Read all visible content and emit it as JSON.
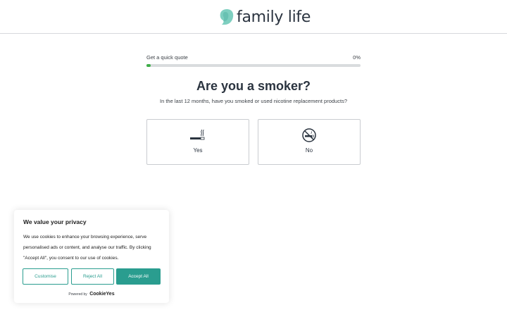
{
  "header": {
    "brand_name": "family life",
    "logo_icon": "family-life-logo-icon",
    "colors": {
      "logo_teal": "#7ecfc0",
      "logo_dark": "#2b3440"
    }
  },
  "progress": {
    "label": "Get a quick quote",
    "percent_label": "0%",
    "value_fraction": 0.02,
    "colors": {
      "fill": "#3fae49",
      "track": "#d9dcde"
    }
  },
  "question": {
    "title": "Are you a smoker?",
    "subtitle": "In the last 12 months, have you smoked or used nicotine replacement products?"
  },
  "options": [
    {
      "label": "Yes",
      "icon": "cigarette-icon"
    },
    {
      "label": "No",
      "icon": "no-smoking-icon"
    }
  ],
  "cookie_banner": {
    "title": "We value your privacy",
    "text": "We use cookies to enhance your browsing experience, serve personalised ads or content, and analyse our traffic. By clicking \"Accept All\", you consent to our use of cookies.",
    "buttons": {
      "customise": "Customise",
      "reject": "Reject All",
      "accept": "Accept All"
    },
    "powered_by": "Powered by",
    "powered_brand": "CookieYes",
    "colors": {
      "accent": "#2a9d8f"
    }
  }
}
